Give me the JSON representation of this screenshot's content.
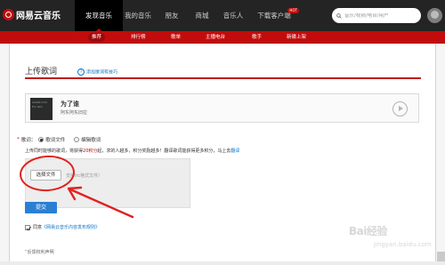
{
  "brand": {
    "name": "网易云音乐"
  },
  "nav": {
    "tabs": [
      {
        "label": "发现音乐",
        "active": true
      },
      {
        "label": "我的音乐",
        "active": false
      },
      {
        "label": "朋友",
        "active": false
      },
      {
        "label": "商城",
        "active": false
      },
      {
        "label": "音乐人",
        "active": false
      },
      {
        "label": "下载客户端",
        "active": false,
        "badge": "HOT"
      }
    ],
    "search_placeholder": "音乐/视频/电台/用户"
  },
  "subnav": {
    "items": [
      {
        "label": "推荐"
      },
      {
        "label": "排行榜"
      },
      {
        "label": "歌单"
      },
      {
        "label": "主播电台"
      },
      {
        "label": "歌手"
      },
      {
        "label": "新碟上架"
      }
    ]
  },
  "page": {
    "title": "上传歌词",
    "tip_link": "添加歌词有技巧"
  },
  "song": {
    "name": "为了谁",
    "artist": "阿东阿东旧拉",
    "cover_text": "ahidut.com For who"
  },
  "lyric": {
    "required_mark": "*",
    "label": "歌词：",
    "option_upload": "歌词文件",
    "option_edit": "编辑歌词",
    "info_prefix": "上传同时能够的歌词，将获得",
    "info_score": "20积分",
    "info_suffix": "起，求的人越多，积分奖励越多！翻译歌词能获得更多积分，马上去",
    "info_link": "翻译"
  },
  "upload": {
    "button": "选择文件",
    "hint": "支持lrc格式文件）"
  },
  "submit": {
    "label": "提交"
  },
  "agree": {
    "prefix": "同意",
    "link": "《网易云音乐内容发布规则》"
  },
  "feedback": {
    "label": "反馈权利声明"
  },
  "watermark": {
    "text": "Bai经验",
    "sub": "jingyan.baidu.com"
  },
  "colors": {
    "brand_red": "#c20c0c",
    "topbar": "#242424",
    "link_blue": "#0c73c2",
    "submit_blue": "#2b7fd3",
    "annotation_red": "#e0221f"
  }
}
